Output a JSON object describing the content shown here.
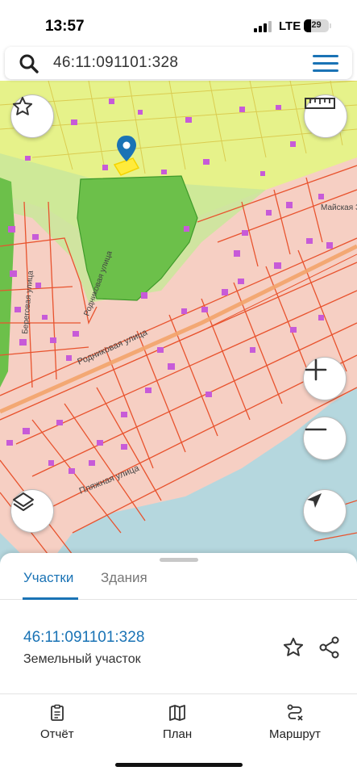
{
  "status_bar": {
    "time": "13:57",
    "network": "LTE",
    "battery_level": "29",
    "battery_fraction": 0.29
  },
  "search": {
    "query": "46:11:091101:328"
  },
  "map": {
    "street_labels": [
      "Родниковая улица",
      "Пляжная улица",
      "Родниковая улица",
      "Майская Зар",
      "Береговая улица"
    ],
    "colors": {
      "selected_parcel": "#ffeb3b",
      "parcel_border": "#e8532e",
      "forest": "#6cc04a",
      "zone": "#e6f28a",
      "water": "#b5d7de",
      "building": "#c75bd8",
      "pin": "#1a73b5"
    }
  },
  "map_controls": {
    "favorite": "star-icon",
    "measure": "ruler-icon",
    "zoom_in": "plus-icon",
    "zoom_out": "minus-icon",
    "layers": "layers-icon",
    "locate": "navigation-arrow-icon"
  },
  "sheet": {
    "tabs": [
      {
        "label": "Участки"
      },
      {
        "label": "Здания"
      }
    ],
    "parcel": {
      "id": "46:11:091101:328",
      "type": "Земельный участок"
    }
  },
  "bottom_nav": [
    {
      "label": "Отчёт",
      "icon": "report-icon"
    },
    {
      "label": "План",
      "icon": "map-icon"
    },
    {
      "label": "Маршрут",
      "icon": "route-icon"
    }
  ],
  "accent_color": "#1a73b5"
}
